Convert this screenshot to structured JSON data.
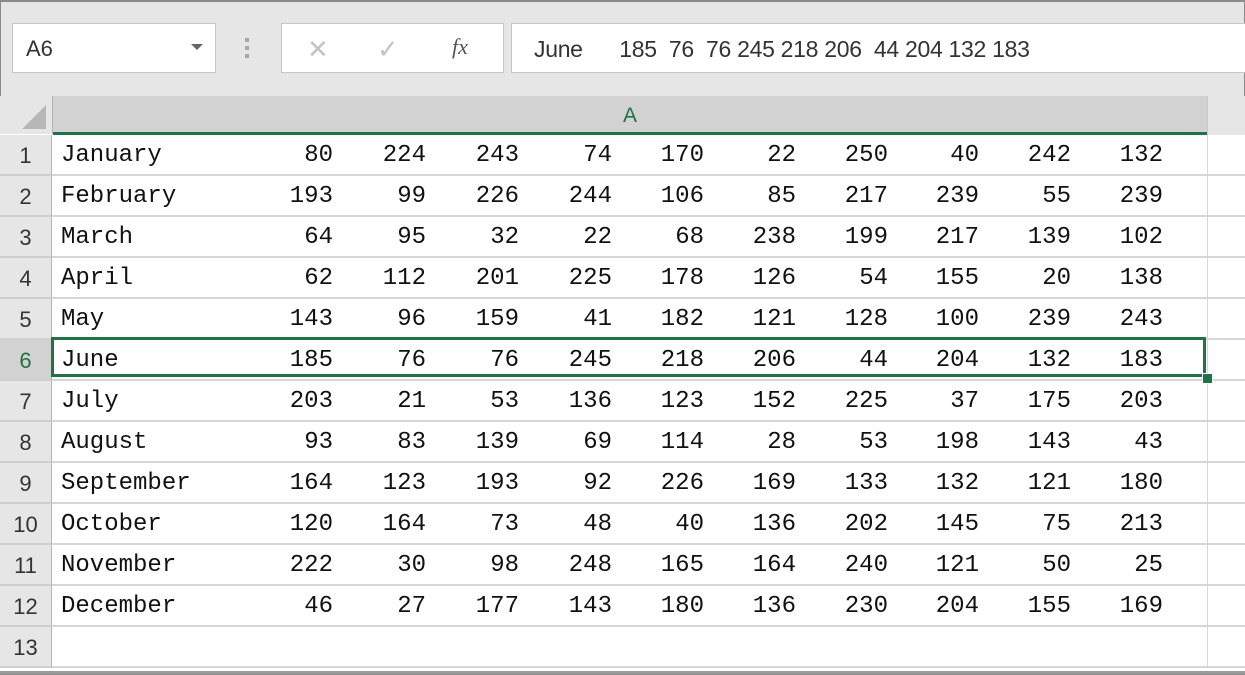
{
  "name_box": {
    "value": "A6"
  },
  "formula_buttons": {
    "cancel": "✕",
    "enter": "✓",
    "fx": "fx"
  },
  "formula_bar": {
    "value": "June      185  76  76 245 218 206  44 204 132 183"
  },
  "column_headers": [
    "A"
  ],
  "selected_cell": "A6",
  "colors": {
    "accent": "#217346"
  },
  "rows": [
    {
      "num": "1",
      "month": "January",
      "values": [
        "80",
        "224",
        "243",
        "74",
        "170",
        "22",
        "250",
        "40",
        "242",
        "132"
      ]
    },
    {
      "num": "2",
      "month": "February",
      "values": [
        "193",
        "99",
        "226",
        "244",
        "106",
        "85",
        "217",
        "239",
        "55",
        "239"
      ]
    },
    {
      "num": "3",
      "month": "March",
      "values": [
        "64",
        "95",
        "32",
        "22",
        "68",
        "238",
        "199",
        "217",
        "139",
        "102"
      ]
    },
    {
      "num": "4",
      "month": "April",
      "values": [
        "62",
        "112",
        "201",
        "225",
        "178",
        "126",
        "54",
        "155",
        "20",
        "138"
      ]
    },
    {
      "num": "5",
      "month": "May",
      "values": [
        "143",
        "96",
        "159",
        "41",
        "182",
        "121",
        "128",
        "100",
        "239",
        "243"
      ]
    },
    {
      "num": "6",
      "month": "June",
      "values": [
        "185",
        "76",
        "76",
        "245",
        "218",
        "206",
        "44",
        "204",
        "132",
        "183"
      ]
    },
    {
      "num": "7",
      "month": "July",
      "values": [
        "203",
        "21",
        "53",
        "136",
        "123",
        "152",
        "225",
        "37",
        "175",
        "203"
      ]
    },
    {
      "num": "8",
      "month": "August",
      "values": [
        "93",
        "83",
        "139",
        "69",
        "114",
        "28",
        "53",
        "198",
        "143",
        "43"
      ]
    },
    {
      "num": "9",
      "month": "September",
      "values": [
        "164",
        "123",
        "193",
        "92",
        "226",
        "169",
        "133",
        "132",
        "121",
        "180"
      ]
    },
    {
      "num": "10",
      "month": "October",
      "values": [
        "120",
        "164",
        "73",
        "48",
        "40",
        "136",
        "202",
        "145",
        "75",
        "213"
      ]
    },
    {
      "num": "11",
      "month": "November",
      "values": [
        "222",
        "30",
        "98",
        "248",
        "165",
        "164",
        "240",
        "121",
        "50",
        "25"
      ]
    },
    {
      "num": "12",
      "month": "December",
      "values": [
        "46",
        "27",
        "177",
        "143",
        "180",
        "136",
        "230",
        "204",
        "155",
        "169"
      ]
    },
    {
      "num": "13",
      "month": "",
      "values": []
    }
  ]
}
